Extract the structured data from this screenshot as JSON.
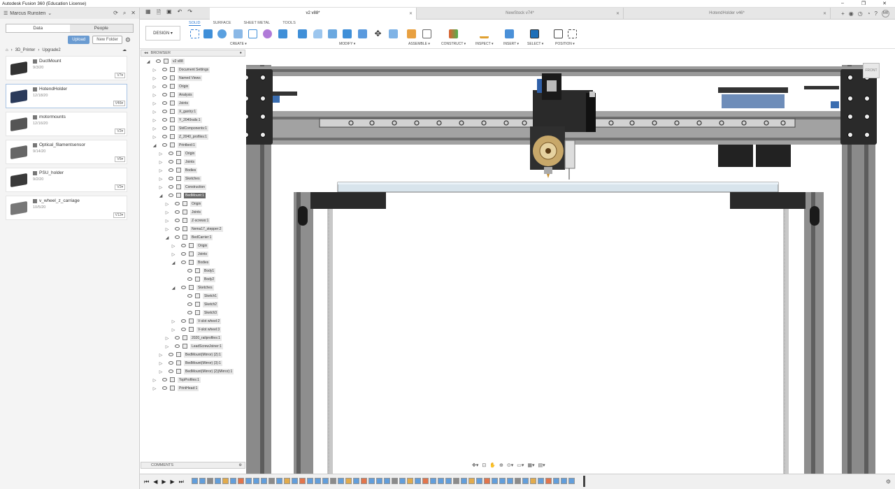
{
  "window": {
    "title": "Autodesk Fusion 360 (Education License)",
    "minimize": "–",
    "maximize": "❐",
    "close": "✕"
  },
  "user": {
    "name": "Marcus Runsten"
  },
  "panel": {
    "tab_data": "Data",
    "tab_people": "People",
    "upload": "Upload",
    "new_folder": "New Folder"
  },
  "breadcrumb": [
    "3D_Printer",
    "Upgrade2"
  ],
  "files": [
    {
      "name": "DuctMount",
      "date": "9/3/20",
      "version": "V7"
    },
    {
      "name": "HotendHolder",
      "date": "12/18/20",
      "version": "V46"
    },
    {
      "name": "motormounts",
      "date": "12/16/20",
      "version": "V2"
    },
    {
      "name": "Optical_filamentsensor",
      "date": "9/14/20",
      "version": "V6"
    },
    {
      "name": "PSU_holder",
      "date": "9/2/20",
      "version": "V2"
    },
    {
      "name": "v_wheel_z_carriage",
      "date": "10/5/20",
      "version": "V12"
    }
  ],
  "doc_tabs": [
    {
      "name": "v2 v88*"
    },
    {
      "name": "NewStock v74*"
    },
    {
      "name": "HotendHolder v46*"
    }
  ],
  "ribbon": {
    "workspace_tabs": [
      "SOLID",
      "SURFACE",
      "SHEET METAL",
      "TOOLS"
    ],
    "design": "DESIGN ▾",
    "groups": [
      "CREATE ▾",
      "MODIFY ▾",
      "ASSEMBLE ▾",
      "CONSTRUCT ▾",
      "INSPECT ▾",
      "INSERT ▾",
      "SELECT ▾",
      "POSITION ▾"
    ]
  },
  "browser": {
    "title": "BROWSER",
    "comments": "COMMENTS"
  },
  "tree": [
    {
      "label": "v2 v88",
      "level": 0,
      "arrow": "◢"
    },
    {
      "label": "Document Settings",
      "level": 1,
      "arrow": "▷"
    },
    {
      "label": "Named Views",
      "level": 1,
      "arrow": "▷"
    },
    {
      "label": "Origin",
      "level": 1,
      "arrow": "▷"
    },
    {
      "label": "Analysis",
      "level": 1,
      "arrow": "▷"
    },
    {
      "label": "Joints",
      "level": 1,
      "arrow": "▷"
    },
    {
      "label": "X_gantry:1",
      "level": 1,
      "arrow": "▷"
    },
    {
      "label": "Y_2040rails:1",
      "level": 1,
      "arrow": "▷"
    },
    {
      "label": "StdComponents:1",
      "level": 1,
      "arrow": "▷"
    },
    {
      "label": "Z_2040_profiles:1",
      "level": 1,
      "arrow": "▷"
    },
    {
      "label": "Printbed:1",
      "level": 1,
      "arrow": "◢"
    },
    {
      "label": "Origin",
      "level": 2,
      "arrow": "▷"
    },
    {
      "label": "Joints",
      "level": 2,
      "arrow": "▷"
    },
    {
      "label": "Bodies",
      "level": 2,
      "arrow": "▷"
    },
    {
      "label": "Sketches",
      "level": 2,
      "arrow": "▷"
    },
    {
      "label": "Construction",
      "level": 2,
      "arrow": "▷"
    },
    {
      "label": "BedMount:1",
      "level": 2,
      "arrow": "◢",
      "highlight": true
    },
    {
      "label": "Origin",
      "level": 3,
      "arrow": "▷"
    },
    {
      "label": "Joints",
      "level": 3,
      "arrow": "▷"
    },
    {
      "label": "Z-screws:1",
      "level": 3,
      "arrow": "▷"
    },
    {
      "label": "Nema17_stepper:2",
      "level": 3,
      "arrow": "▷"
    },
    {
      "label": "BedCarrier:1",
      "level": 3,
      "arrow": "◢"
    },
    {
      "label": "Origin",
      "level": 4,
      "arrow": "▷"
    },
    {
      "label": "Joints",
      "level": 4,
      "arrow": "▷"
    },
    {
      "label": "Bodies",
      "level": 4,
      "arrow": "◢"
    },
    {
      "label": "Body1",
      "level": 5,
      "arrow": ""
    },
    {
      "label": "Body2",
      "level": 5,
      "arrow": ""
    },
    {
      "label": "Sketches",
      "level": 4,
      "arrow": "◢"
    },
    {
      "label": "Sketch1",
      "level": 5,
      "arrow": ""
    },
    {
      "label": "Sketch2",
      "level": 5,
      "arrow": ""
    },
    {
      "label": "Sketch3",
      "level": 5,
      "arrow": ""
    },
    {
      "label": "V-slot wheel:2",
      "level": 4,
      "arrow": "▷"
    },
    {
      "label": "V-slot wheel:3",
      "level": 4,
      "arrow": "▷"
    },
    {
      "label": "2020_railprofiles:1",
      "level": 3,
      "arrow": "▷"
    },
    {
      "label": "LeadScrewJoiner:1",
      "level": 3,
      "arrow": "▷"
    },
    {
      "label": "BedMount(Mirror) (2):1",
      "level": 2,
      "arrow": "▷"
    },
    {
      "label": "BedMount(Mirror) (3):1",
      "level": 2,
      "arrow": "▷"
    },
    {
      "label": "BedMount(Mirror) (2)(Mirror):1",
      "level": 2,
      "arrow": "▷"
    },
    {
      "label": "TopProfiles:1",
      "level": 1,
      "arrow": "▷"
    },
    {
      "label": "PrintHead:1",
      "level": 1,
      "arrow": "▷"
    }
  ],
  "viewcube": "FRONT",
  "colors": {
    "accent": "#2d7bd4",
    "upload": "#6a9bd1",
    "frame": "#8a8a8a",
    "dark": "#333333",
    "fan": "#c8a86a",
    "bed": "#d8e4ec"
  }
}
